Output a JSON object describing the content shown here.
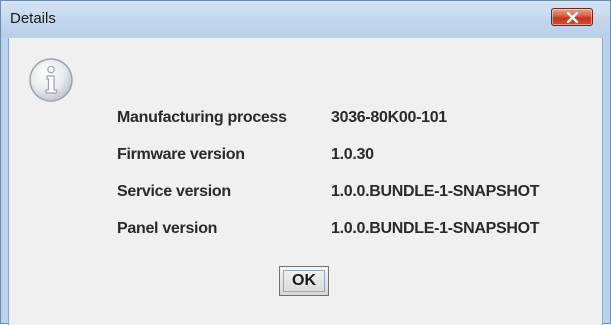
{
  "window": {
    "title": "Details"
  },
  "icons": {
    "info": "info-icon",
    "close": "close-icon"
  },
  "details": [
    {
      "label": "Manufacturing process",
      "value": "3036-80K00-101"
    },
    {
      "label": "Firmware version",
      "value": "1.0.30"
    },
    {
      "label": "Service version",
      "value": "1.0.0.BUNDLE-1-SNAPSHOT"
    },
    {
      "label": "Panel version",
      "value": "1.0.0.BUNDLE-1-SNAPSHOT"
    }
  ],
  "buttons": {
    "ok_label": "OK"
  }
}
